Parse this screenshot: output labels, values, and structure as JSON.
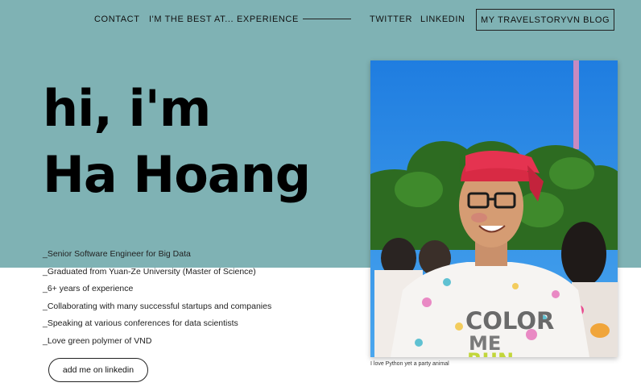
{
  "nav": {
    "contact": "CONTACT",
    "best_at": "I'M THE BEST AT...",
    "experience": "EXPERIENCE",
    "twitter": "TWITTER",
    "linkedin": "LINKEDIN",
    "blog": "MY TRAVELSTORYVN BLOG"
  },
  "hero": {
    "line1": "hi, i'm",
    "line2": "Ha Hoang"
  },
  "bullets": [
    "_Senior Software Engineer for Big Data",
    "_Graduated from Yuan-Ze University (Master of Science)",
    "_6+ years of experience",
    "_Collaborating with many successful startups and companies",
    "_Speaking at various conferences for data scientists",
    "_Love green polymer of VND"
  ],
  "cta": {
    "label": "add me on linkedin"
  },
  "photo": {
    "shirt_text": [
      "COLOR",
      "ME",
      "RUN"
    ],
    "caption": "I love Python yet a party animal"
  },
  "colors": {
    "background_top": "#7fb2b4",
    "background_bottom": "#ffffff",
    "text": "#000000",
    "cap_red": "#d82a44"
  }
}
